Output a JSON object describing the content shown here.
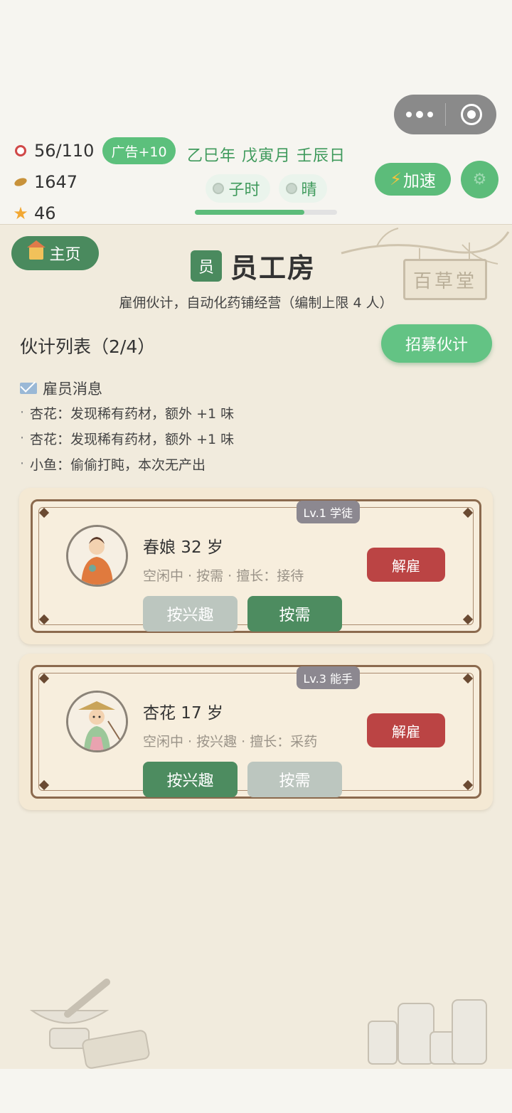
{
  "capsule": {
    "more_icon": "more-dots-icon",
    "close_icon": "target-circle-icon"
  },
  "stats": {
    "hp": "56/110",
    "coins": "1647",
    "stars": "46",
    "ad_label": "广告+10"
  },
  "date": {
    "text": "乙巳年 戊寅月 壬辰日",
    "hour": "子时",
    "weather": "晴",
    "time_progress": 0.77
  },
  "toolbar": {
    "speed_label": "加速"
  },
  "page": {
    "home_label": "主页",
    "title_icon": "员",
    "title": "员工房",
    "subtitle": "雇佣伙计，自动化药铺经营（编制上限 4 人）",
    "list_title": "伙计列表（2/4）",
    "recruit_label": "招募伙计",
    "sign_text": "百草堂"
  },
  "messages": {
    "title": "雇员消息",
    "items": [
      "杏花：发现稀有药材，额外 +1 味",
      "杏花：发现稀有药材，额外 +1 味",
      "小鱼：偷偷打盹，本次无产出"
    ]
  },
  "employees": [
    {
      "level": "Lv.1 学徒",
      "name": "春娘 32 岁",
      "info": "空闲中 · 按需 · 擅长：接待",
      "fire_label": "解雇",
      "mode_interest": "按兴趣",
      "mode_demand": "按需",
      "active_mode": "demand"
    },
    {
      "level": "Lv.3 能手",
      "name": "杏花 17 岁",
      "info": "空闲中 · 按兴趣 · 擅长：采药",
      "fire_label": "解雇",
      "mode_interest": "按兴趣",
      "mode_demand": "按需",
      "active_mode": "interest"
    }
  ],
  "colors": {
    "accent_green": "#5cbc7a",
    "dark_green": "#4a8a5e",
    "fire_red": "#bb4444",
    "panel_bg": "#f1ebdd"
  }
}
